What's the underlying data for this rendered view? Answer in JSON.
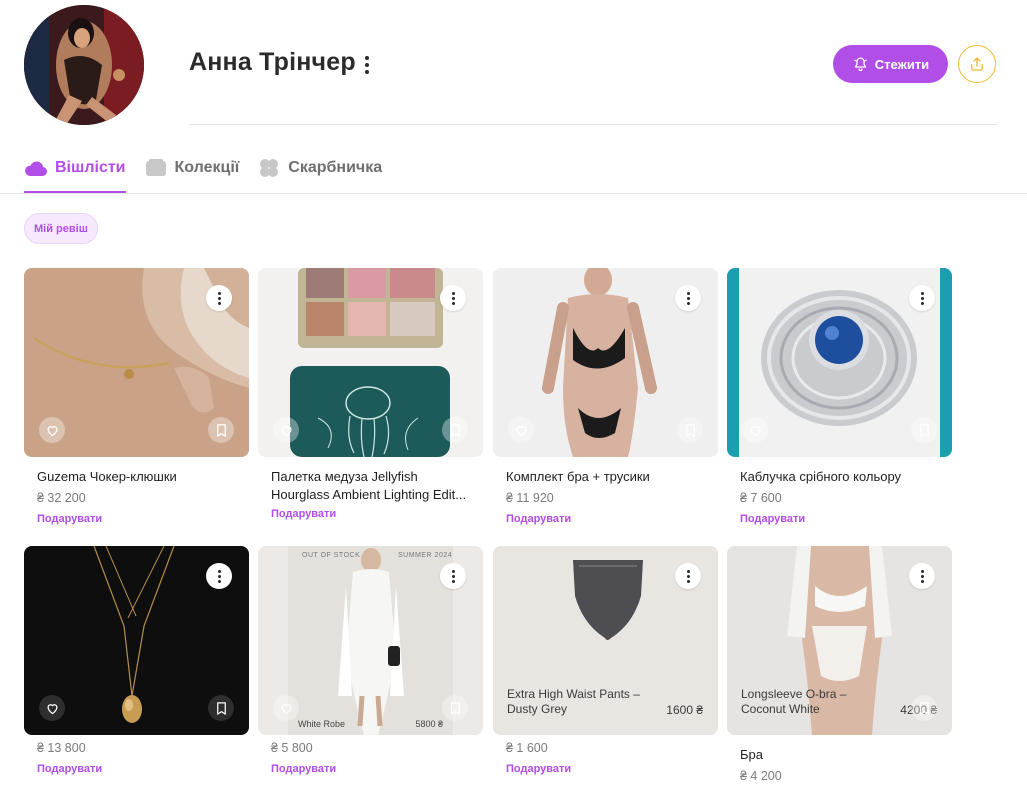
{
  "profile": {
    "name": "Анна Трінчер",
    "follow_label": "Стежити"
  },
  "tabs": [
    {
      "label": "Вішлісти",
      "active": true
    },
    {
      "label": "Колекції",
      "active": false
    },
    {
      "label": "Скарбничка",
      "active": false
    }
  ],
  "filter_chip": "Мій ревіш",
  "gift_label": "Подарувати",
  "colors": {
    "accent": "#b24ee8",
    "share_border": "#f0b83a"
  },
  "products": [
    {
      "title": "Guzema Чокер-клюшки",
      "price": "₴ 32 200"
    },
    {
      "title": "Палетка медуза Jellyfish Hourglass Ambient Lighting Edit...",
      "price": ""
    },
    {
      "title": "Комплект бра + трусики",
      "price": "₴ 11 920"
    },
    {
      "title": "Каблучка срібного кольору",
      "price": "₴ 7 600"
    },
    {
      "title": "",
      "price": "₴ 13 800"
    },
    {
      "title": "",
      "price": "₴ 5 800",
      "overlay_title": "White Robe",
      "overlay_price": "5800 ₴",
      "overlay_top_left": "OUT OF STOCK",
      "overlay_top_right": "SUMMER 2024"
    },
    {
      "title": "",
      "price": "₴ 1 600",
      "overlay_title": "Extra High Waist Pants – Dusty Grey",
      "overlay_price": "1600 ₴"
    },
    {
      "title": "Бра",
      "price": "₴ 4 200",
      "overlay_title": "Longsleeve O-bra – Coconut White",
      "overlay_price": "4200 ₴"
    }
  ]
}
